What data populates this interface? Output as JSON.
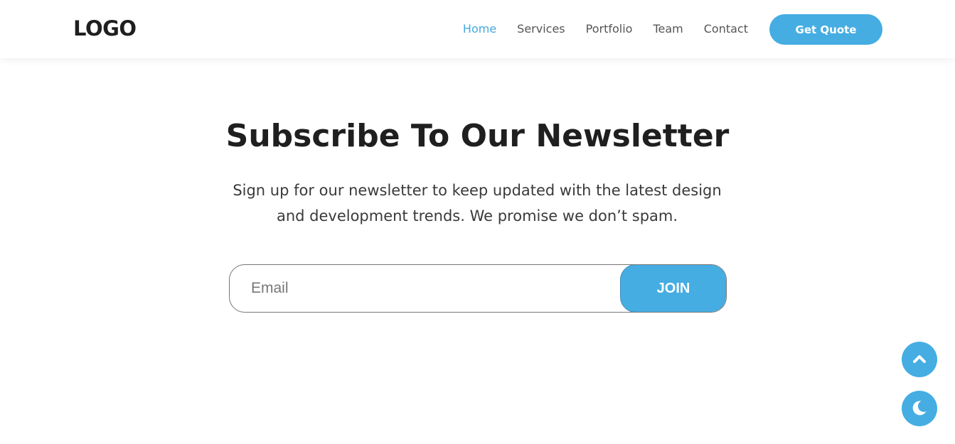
{
  "header": {
    "logo": "LOGO",
    "nav": [
      {
        "label": "Home",
        "active": true
      },
      {
        "label": "Services",
        "active": false
      },
      {
        "label": "Portfolio",
        "active": false
      },
      {
        "label": "Team",
        "active": false
      },
      {
        "label": "Contact",
        "active": false
      }
    ],
    "cta_label": "Get Quote"
  },
  "newsletter": {
    "title": "Subscribe To Our Newsletter",
    "description": "Sign up for our newsletter to keep updated with the latest design and development trends. We promise we don’t spam.",
    "email_placeholder": "Email",
    "email_value": "",
    "join_label": "JOIN"
  },
  "floating_buttons": {
    "scroll_top_icon": "chevron-up-icon",
    "theme_toggle_icon": "moon-icon"
  },
  "colors": {
    "accent": "#45ade2",
    "nav_active": "#45a9de",
    "text_dark": "#1f1f1f",
    "text_muted": "#555555"
  }
}
